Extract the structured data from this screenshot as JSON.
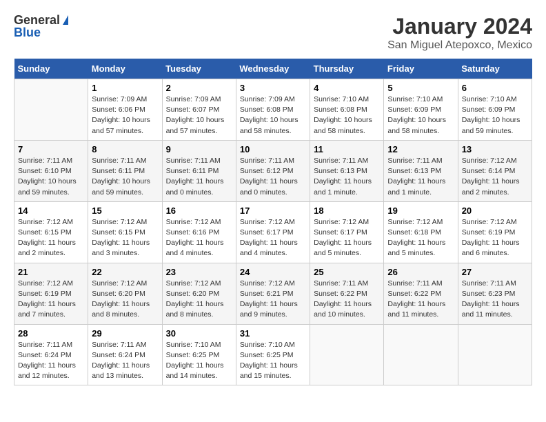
{
  "logo": {
    "general": "General",
    "blue": "Blue"
  },
  "title": "January 2024",
  "subtitle": "San Miguel Atepoxco, Mexico",
  "days_of_week": [
    "Sunday",
    "Monday",
    "Tuesday",
    "Wednesday",
    "Thursday",
    "Friday",
    "Saturday"
  ],
  "weeks": [
    [
      {
        "day": "",
        "info": ""
      },
      {
        "day": "1",
        "info": "Sunrise: 7:09 AM\nSunset: 6:06 PM\nDaylight: 10 hours\nand 57 minutes."
      },
      {
        "day": "2",
        "info": "Sunrise: 7:09 AM\nSunset: 6:07 PM\nDaylight: 10 hours\nand 57 minutes."
      },
      {
        "day": "3",
        "info": "Sunrise: 7:09 AM\nSunset: 6:08 PM\nDaylight: 10 hours\nand 58 minutes."
      },
      {
        "day": "4",
        "info": "Sunrise: 7:10 AM\nSunset: 6:08 PM\nDaylight: 10 hours\nand 58 minutes."
      },
      {
        "day": "5",
        "info": "Sunrise: 7:10 AM\nSunset: 6:09 PM\nDaylight: 10 hours\nand 58 minutes."
      },
      {
        "day": "6",
        "info": "Sunrise: 7:10 AM\nSunset: 6:09 PM\nDaylight: 10 hours\nand 59 minutes."
      }
    ],
    [
      {
        "day": "7",
        "info": "Sunrise: 7:11 AM\nSunset: 6:10 PM\nDaylight: 10 hours\nand 59 minutes."
      },
      {
        "day": "8",
        "info": "Sunrise: 7:11 AM\nSunset: 6:11 PM\nDaylight: 10 hours\nand 59 minutes."
      },
      {
        "day": "9",
        "info": "Sunrise: 7:11 AM\nSunset: 6:11 PM\nDaylight: 11 hours\nand 0 minutes."
      },
      {
        "day": "10",
        "info": "Sunrise: 7:11 AM\nSunset: 6:12 PM\nDaylight: 11 hours\nand 0 minutes."
      },
      {
        "day": "11",
        "info": "Sunrise: 7:11 AM\nSunset: 6:13 PM\nDaylight: 11 hours\nand 1 minute."
      },
      {
        "day": "12",
        "info": "Sunrise: 7:11 AM\nSunset: 6:13 PM\nDaylight: 11 hours\nand 1 minute."
      },
      {
        "day": "13",
        "info": "Sunrise: 7:12 AM\nSunset: 6:14 PM\nDaylight: 11 hours\nand 2 minutes."
      }
    ],
    [
      {
        "day": "14",
        "info": "Sunrise: 7:12 AM\nSunset: 6:15 PM\nDaylight: 11 hours\nand 2 minutes."
      },
      {
        "day": "15",
        "info": "Sunrise: 7:12 AM\nSunset: 6:15 PM\nDaylight: 11 hours\nand 3 minutes."
      },
      {
        "day": "16",
        "info": "Sunrise: 7:12 AM\nSunset: 6:16 PM\nDaylight: 11 hours\nand 4 minutes."
      },
      {
        "day": "17",
        "info": "Sunrise: 7:12 AM\nSunset: 6:17 PM\nDaylight: 11 hours\nand 4 minutes."
      },
      {
        "day": "18",
        "info": "Sunrise: 7:12 AM\nSunset: 6:17 PM\nDaylight: 11 hours\nand 5 minutes."
      },
      {
        "day": "19",
        "info": "Sunrise: 7:12 AM\nSunset: 6:18 PM\nDaylight: 11 hours\nand 5 minutes."
      },
      {
        "day": "20",
        "info": "Sunrise: 7:12 AM\nSunset: 6:19 PM\nDaylight: 11 hours\nand 6 minutes."
      }
    ],
    [
      {
        "day": "21",
        "info": "Sunrise: 7:12 AM\nSunset: 6:19 PM\nDaylight: 11 hours\nand 7 minutes."
      },
      {
        "day": "22",
        "info": "Sunrise: 7:12 AM\nSunset: 6:20 PM\nDaylight: 11 hours\nand 8 minutes."
      },
      {
        "day": "23",
        "info": "Sunrise: 7:12 AM\nSunset: 6:20 PM\nDaylight: 11 hours\nand 8 minutes."
      },
      {
        "day": "24",
        "info": "Sunrise: 7:12 AM\nSunset: 6:21 PM\nDaylight: 11 hours\nand 9 minutes."
      },
      {
        "day": "25",
        "info": "Sunrise: 7:11 AM\nSunset: 6:22 PM\nDaylight: 11 hours\nand 10 minutes."
      },
      {
        "day": "26",
        "info": "Sunrise: 7:11 AM\nSunset: 6:22 PM\nDaylight: 11 hours\nand 11 minutes."
      },
      {
        "day": "27",
        "info": "Sunrise: 7:11 AM\nSunset: 6:23 PM\nDaylight: 11 hours\nand 11 minutes."
      }
    ],
    [
      {
        "day": "28",
        "info": "Sunrise: 7:11 AM\nSunset: 6:24 PM\nDaylight: 11 hours\nand 12 minutes."
      },
      {
        "day": "29",
        "info": "Sunrise: 7:11 AM\nSunset: 6:24 PM\nDaylight: 11 hours\nand 13 minutes."
      },
      {
        "day": "30",
        "info": "Sunrise: 7:10 AM\nSunset: 6:25 PM\nDaylight: 11 hours\nand 14 minutes."
      },
      {
        "day": "31",
        "info": "Sunrise: 7:10 AM\nSunset: 6:25 PM\nDaylight: 11 hours\nand 15 minutes."
      },
      {
        "day": "",
        "info": ""
      },
      {
        "day": "",
        "info": ""
      },
      {
        "day": "",
        "info": ""
      }
    ]
  ]
}
